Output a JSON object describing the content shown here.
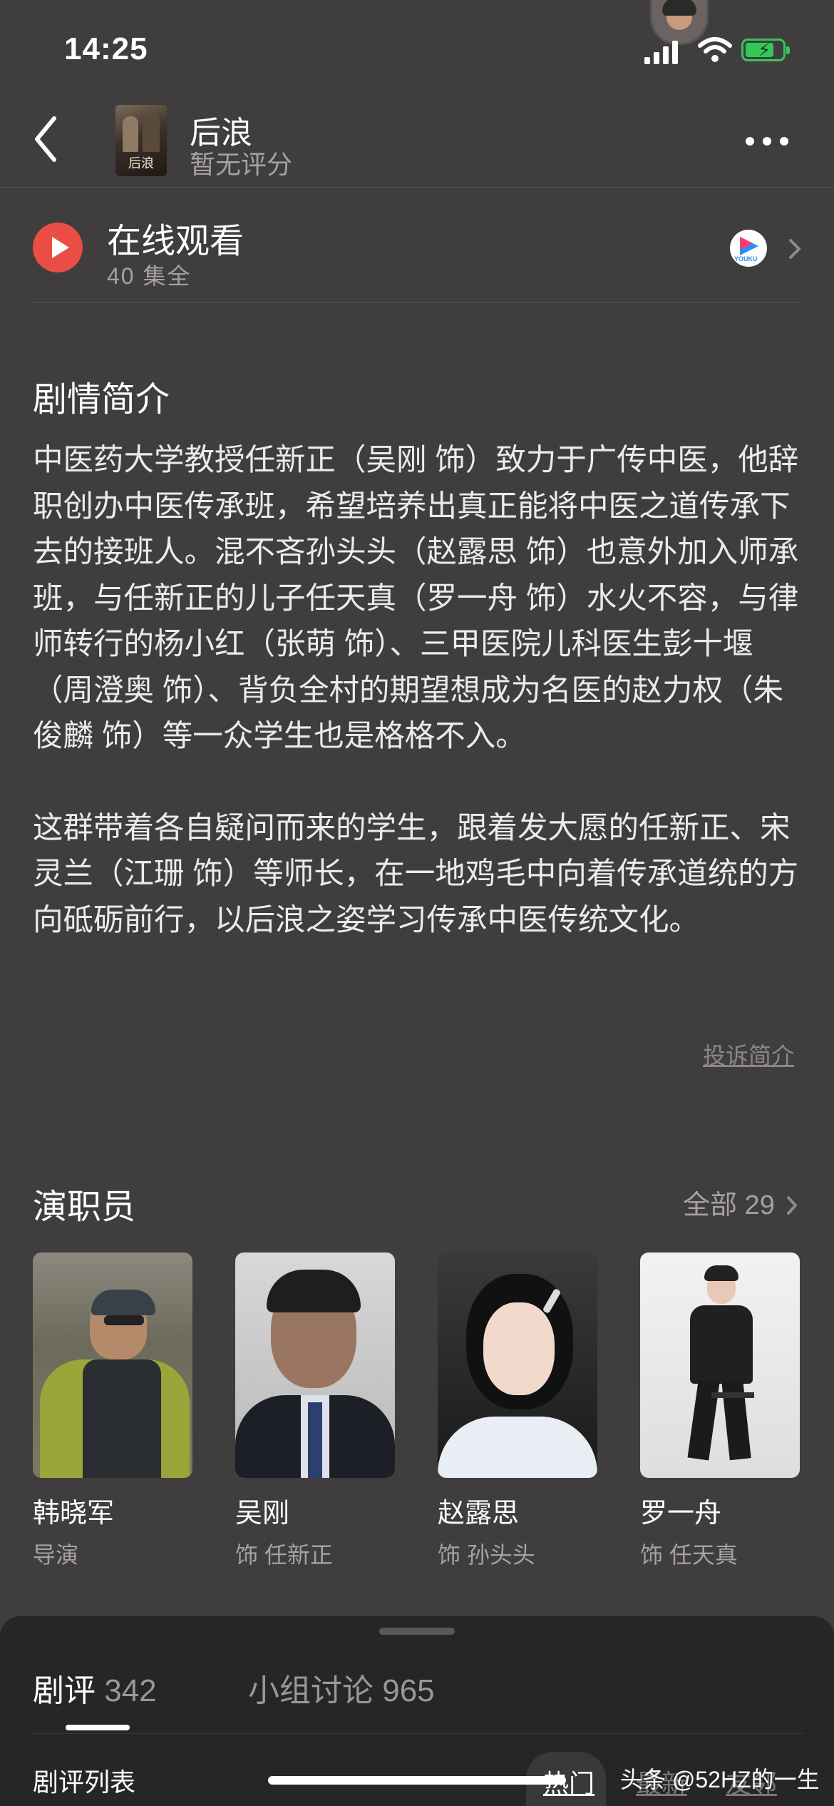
{
  "status": {
    "time": "14:25"
  },
  "nav": {
    "title": "后浪",
    "subtitle": "暂无评分",
    "poster_title": "后浪"
  },
  "watch": {
    "title": "在线观看",
    "episodes": "40 集全",
    "provider_label": "YOUKU"
  },
  "synopsis": {
    "heading": "剧情简介",
    "paragraphs": [
      "中医药大学教授任新正（吴刚 饰）致力于广传中医，他辞职创办中医传承班，希望培养出真正能将中医之道传承下去的接班人。混不吝孙头头（赵露思 饰）也意外加入师承班，与任新正的儿子任天真（罗一舟 饰）水火不容，与律师转行的杨小红（张萌 饰）、三甲医院儿科医生彭十堰（周澄奥 饰）、背负全村的期望想成为名医的赵力权（朱俊麟 饰）等一众学生也是格格不入。",
      "这群带着各自疑问而来的学生，跟着发大愿的任新正、宋灵兰（江珊 饰）等师长，在一地鸡毛中向着传承道统的方向砥砺前行，以后浪之姿学习传承中医传统文化。"
    ],
    "report_link": "投诉简介"
  },
  "cast": {
    "heading": "演职员",
    "all_label": "全部 29",
    "members": [
      {
        "name": "韩晓军",
        "role": "导演"
      },
      {
        "name": "吴刚",
        "role": "饰 任新正"
      },
      {
        "name": "赵露思",
        "role": "饰 孙头头"
      },
      {
        "name": "罗一舟",
        "role": "饰 任天真"
      }
    ]
  },
  "reviews": {
    "tab_reviews_label": "剧评",
    "tab_reviews_count": "342",
    "tab_group_label": "小组讨论 965",
    "list_label": "剧评列表",
    "sort_hot": "热门",
    "sort_latest": "最新",
    "sort_tag": "友邻"
  },
  "watermark": "头条 @52HZ的一生",
  "colors": {
    "background": "#3f3d3d",
    "play_red": "#ea4d44",
    "battery_green": "#35c759",
    "sheet": "#262626"
  }
}
